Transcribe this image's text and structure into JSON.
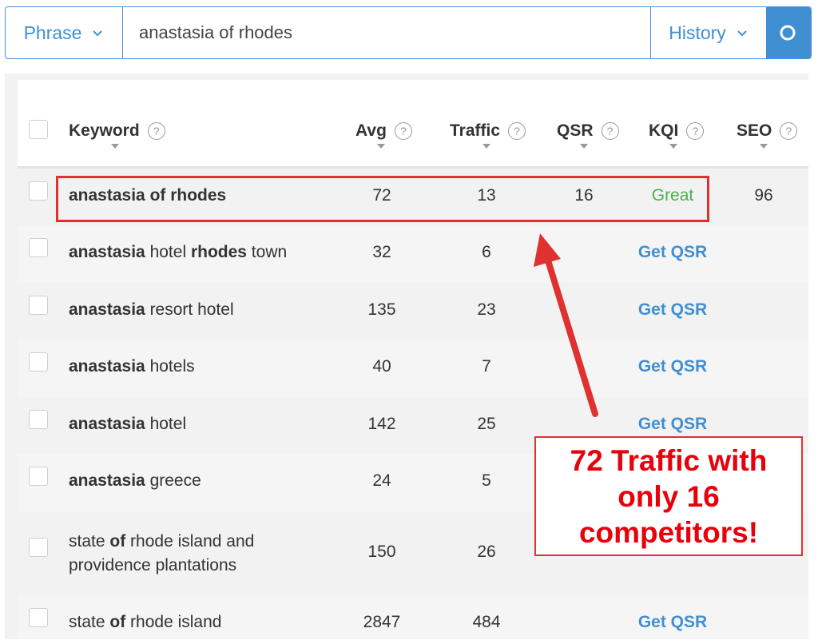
{
  "search": {
    "mode_label": "Phrase",
    "query": "anastasia of rhodes",
    "history_label": "History"
  },
  "table": {
    "columns": [
      {
        "label": "Keyword"
      },
      {
        "label": "Avg"
      },
      {
        "label": "Traffic"
      },
      {
        "label": "QSR"
      },
      {
        "label": "KQI"
      },
      {
        "label": "SEO"
      }
    ],
    "help_glyph": "?",
    "rows": [
      {
        "keyword_parts": [
          [
            "anastasia of rhodes",
            true
          ]
        ],
        "avg": "72",
        "traffic": "13",
        "qsr": "16",
        "kqi": "Great",
        "seo": "96"
      },
      {
        "keyword_parts": [
          [
            "anastasia",
            true
          ],
          [
            " hotel ",
            false
          ],
          [
            "rhodes",
            true
          ],
          [
            " town",
            false
          ]
        ],
        "avg": "32",
        "traffic": "6",
        "qsr": "",
        "kqi_link": "Get QSR",
        "seo": ""
      },
      {
        "keyword_parts": [
          [
            "anastasia",
            true
          ],
          [
            " resort hotel",
            false
          ]
        ],
        "avg": "135",
        "traffic": "23",
        "qsr": "",
        "kqi_link": "Get QSR",
        "seo": ""
      },
      {
        "keyword_parts": [
          [
            "anastasia",
            true
          ],
          [
            " hotels",
            false
          ]
        ],
        "avg": "40",
        "traffic": "7",
        "qsr": "",
        "kqi_link": "Get QSR",
        "seo": ""
      },
      {
        "keyword_parts": [
          [
            "anastasia",
            true
          ],
          [
            " hotel",
            false
          ]
        ],
        "avg": "142",
        "traffic": "25",
        "qsr": "",
        "kqi_link": "Get QSR",
        "seo": ""
      },
      {
        "keyword_parts": [
          [
            "anastasia",
            true
          ],
          [
            " greece",
            false
          ]
        ],
        "avg": "24",
        "traffic": "5",
        "qsr": "",
        "kqi_link": "",
        "seo": ""
      },
      {
        "keyword_line1": [
          [
            "state ",
            false
          ],
          [
            "of",
            true
          ],
          [
            " rhode island and",
            false
          ]
        ],
        "keyword_line2": "providence plantations",
        "avg": "150",
        "traffic": "26",
        "qsr": "",
        "kqi_link": "",
        "seo": ""
      },
      {
        "keyword_parts": [
          [
            "state ",
            false
          ],
          [
            "of",
            true
          ],
          [
            " rhode island",
            false
          ]
        ],
        "avg": "2847",
        "traffic": "484",
        "qsr": "",
        "kqi_link": "Get QSR",
        "seo": ""
      }
    ]
  },
  "annotation": {
    "line1": "72 Traffic with",
    "line2": "only 16",
    "line3": "competitors!"
  },
  "colors": {
    "accent": "#3f8fd2",
    "great": "#4caf50",
    "annotation_red": "#e8000b"
  }
}
